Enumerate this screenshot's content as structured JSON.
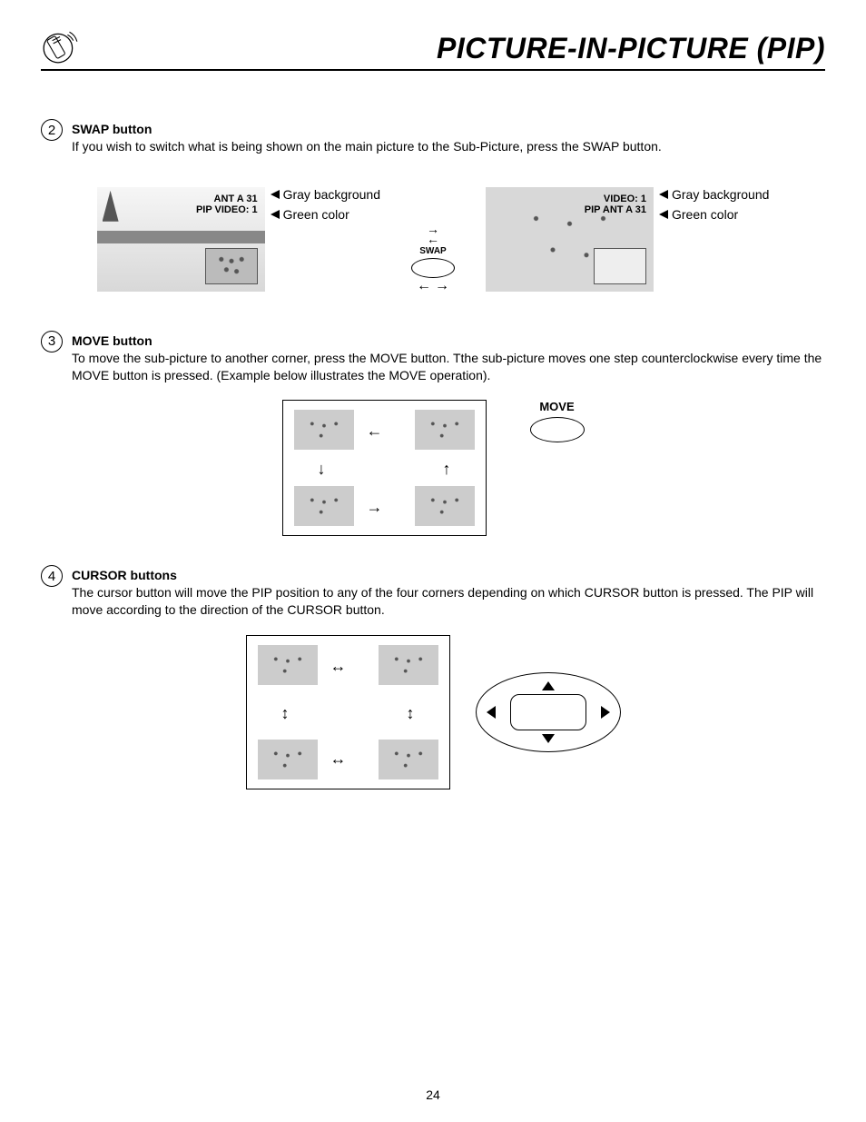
{
  "header": {
    "title": "PICTURE-IN-PICTURE (PIP)"
  },
  "steps": {
    "swap": {
      "num": "2",
      "title": "SWAP button",
      "text": "If you wish to switch what is being shown on the main picture to the Sub-Picture, press the SWAP button."
    },
    "move": {
      "num": "3",
      "title": "MOVE button",
      "text": "To move the sub-picture to another corner, press the MOVE button. Tthe sub-picture moves one step counterclockwise every time the MOVE button is pressed.  (Example below illustrates the MOVE operation)."
    },
    "cursor": {
      "num": "4",
      "title": "CURSOR buttons",
      "text": "The cursor button will move the PIP position to any of the four corners depending on which CURSOR button is pressed.  The PIP will move according to the direction of the CURSOR button."
    }
  },
  "tv_left": {
    "line1": "ANT  A 31",
    "line2": "PIP  VIDEO: 1"
  },
  "tv_right": {
    "line1": "VIDEO: 1",
    "line2": "PIP  ANT  A 31"
  },
  "anno": {
    "gray": "Gray background",
    "green": "Green color"
  },
  "buttons": {
    "swap": "SWAP",
    "move": "MOVE"
  },
  "page_number": "24"
}
